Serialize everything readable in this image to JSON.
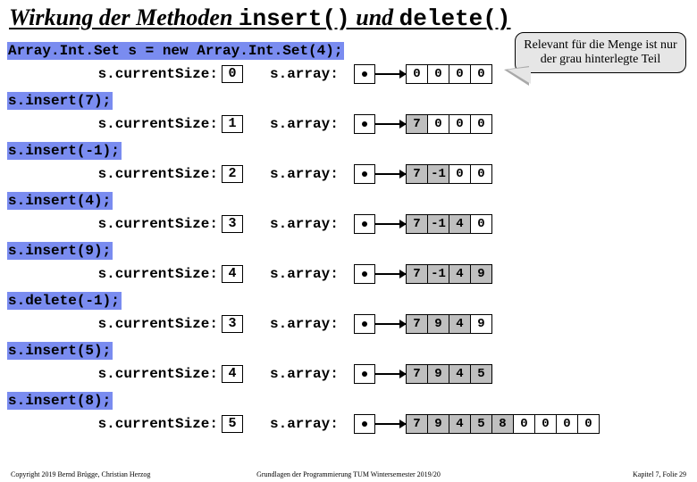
{
  "title_pre": "Wirkung der Methoden ",
  "title_c1": "insert()",
  "title_mid": " und ",
  "title_c2": "delete()",
  "init_cmd": "Array.Int.Set s = new Array.Int.Set(4);",
  "lbl_curr": "s.currentSize:",
  "lbl_arr": "s.array:",
  "callout": "Relevant für die Menge ist nur der grau hinterlegte Teil",
  "steps": [
    {
      "cmd": "",
      "size": "0",
      "cells": [
        {
          "v": "0"
        },
        {
          "v": "0"
        },
        {
          "v": "0"
        },
        {
          "v": "0"
        }
      ]
    },
    {
      "cmd": "s.insert(7);",
      "size": "1",
      "cells": [
        {
          "v": "7",
          "s": 1
        },
        {
          "v": "0"
        },
        {
          "v": "0"
        },
        {
          "v": "0"
        }
      ]
    },
    {
      "cmd": "s.insert(-1);",
      "size": "2",
      "cells": [
        {
          "v": "7",
          "s": 1
        },
        {
          "v": "-1",
          "s": 1
        },
        {
          "v": "0"
        },
        {
          "v": "0"
        }
      ]
    },
    {
      "cmd": "s.insert(4);",
      "size": "3",
      "cells": [
        {
          "v": "7",
          "s": 1
        },
        {
          "v": "-1",
          "s": 1
        },
        {
          "v": "4",
          "s": 1
        },
        {
          "v": "0"
        }
      ]
    },
    {
      "cmd": "s.insert(9);",
      "size": "4",
      "cells": [
        {
          "v": "7",
          "s": 1
        },
        {
          "v": "-1",
          "s": 1
        },
        {
          "v": "4",
          "s": 1
        },
        {
          "v": "9",
          "s": 1
        }
      ]
    },
    {
      "cmd": "s.delete(-1);",
      "size": "3",
      "cells": [
        {
          "v": "7",
          "s": 1
        },
        {
          "v": "9",
          "s": 1
        },
        {
          "v": "4",
          "s": 1
        },
        {
          "v": "9"
        }
      ]
    },
    {
      "cmd": "s.insert(5);",
      "size": "4",
      "cells": [
        {
          "v": "7",
          "s": 1
        },
        {
          "v": "9",
          "s": 1
        },
        {
          "v": "4",
          "s": 1
        },
        {
          "v": "5",
          "s": 1
        }
      ]
    },
    {
      "cmd": "s.insert(8);",
      "size": "5",
      "cells": [
        {
          "v": "7",
          "s": 1
        },
        {
          "v": "9",
          "s": 1
        },
        {
          "v": "4",
          "s": 1
        },
        {
          "v": "5",
          "s": 1
        },
        {
          "v": "8",
          "s": 1
        },
        {
          "v": "0"
        },
        {
          "v": "0"
        },
        {
          "v": "0"
        },
        {
          "v": "0"
        }
      ]
    }
  ],
  "foot_l": "Copyright 2019 Bernd Brügge, Christian Herzog",
  "foot_m": "Grundlagen der Programmierung TUM Wintersemester 2019/20",
  "foot_r": "Kapitel 7, Folie 29"
}
